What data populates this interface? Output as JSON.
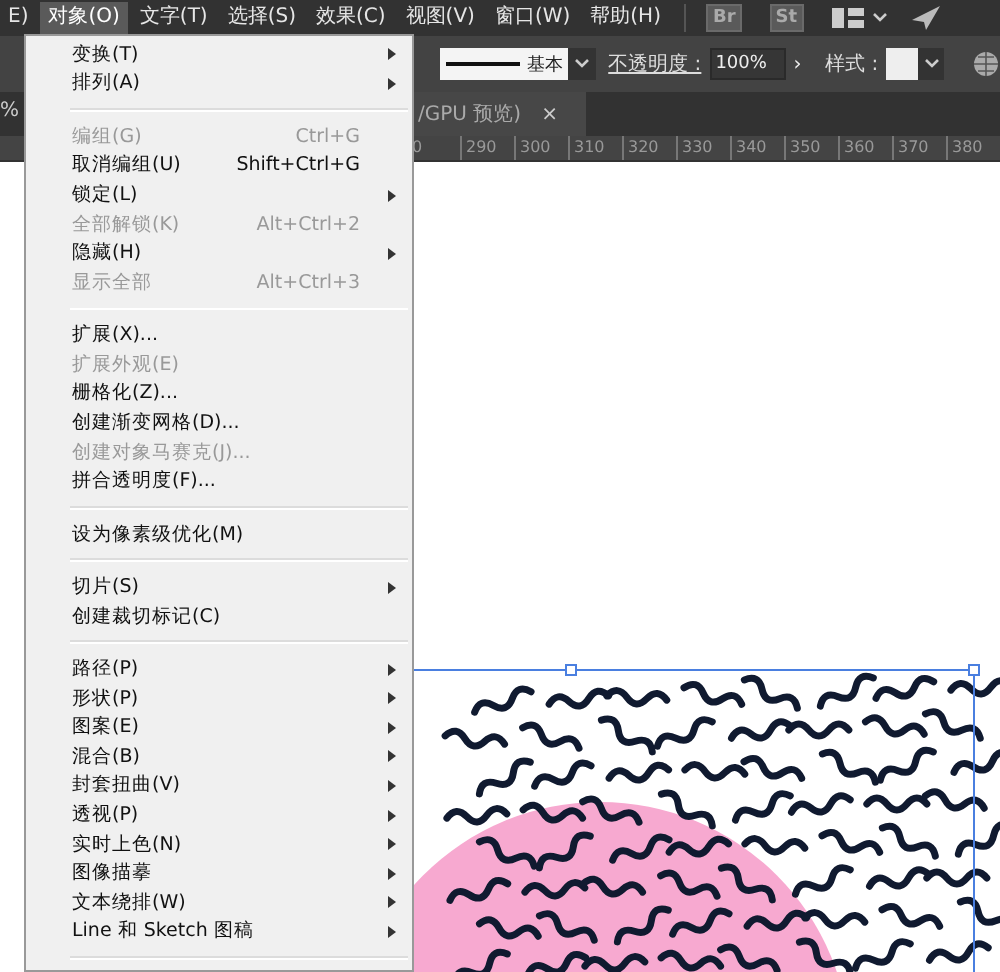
{
  "menubar": {
    "items": [
      {
        "label": "E)",
        "selected": false
      },
      {
        "label": "对象(O)",
        "selected": true
      },
      {
        "label": "文字(T)",
        "selected": false
      },
      {
        "label": "选择(S)",
        "selected": false
      },
      {
        "label": "效果(C)",
        "selected": false
      },
      {
        "label": "视图(V)",
        "selected": false
      },
      {
        "label": "窗口(W)",
        "selected": false
      },
      {
        "label": "帮助(H)",
        "selected": false
      }
    ],
    "apps": [
      "Br",
      "St"
    ]
  },
  "control_bar": {
    "left_fragment": "%",
    "stroke_label": "基本",
    "opacity_label": "不透明度 :",
    "opacity_value": "100%",
    "opacity_arrow": "›",
    "style_label": "样式 :"
  },
  "document_tab": {
    "title": "/GPU 预览)",
    "close": "×"
  },
  "ruler": {
    "ticks": [
      "0",
      "290",
      "300",
      "310",
      "320",
      "330",
      "340",
      "350",
      "360",
      "370",
      "380"
    ]
  },
  "menu": {
    "items": [
      {
        "kind": "item",
        "label": "变换(T)",
        "submenu": true,
        "disabled": false
      },
      {
        "kind": "item",
        "label": "排列(A)",
        "submenu": true,
        "disabled": false
      },
      {
        "kind": "separator"
      },
      {
        "kind": "item",
        "label": "编组(G)",
        "shortcut": "Ctrl+G",
        "submenu": false,
        "disabled": true
      },
      {
        "kind": "item",
        "label": "取消编组(U)",
        "shortcut": "Shift+Ctrl+G",
        "submenu": false,
        "disabled": false
      },
      {
        "kind": "item",
        "label": "锁定(L)",
        "submenu": true,
        "disabled": false
      },
      {
        "kind": "item",
        "label": "全部解锁(K)",
        "shortcut": "Alt+Ctrl+2",
        "submenu": false,
        "disabled": true
      },
      {
        "kind": "item",
        "label": "隐藏(H)",
        "submenu": true,
        "disabled": false
      },
      {
        "kind": "item",
        "label": "显示全部",
        "shortcut": "Alt+Ctrl+3",
        "submenu": false,
        "disabled": true
      },
      {
        "kind": "separator"
      },
      {
        "kind": "item",
        "label": "扩展(X)...",
        "submenu": false,
        "disabled": false
      },
      {
        "kind": "item",
        "label": "扩展外观(E)",
        "submenu": false,
        "disabled": true
      },
      {
        "kind": "item",
        "label": "栅格化(Z)...",
        "submenu": false,
        "disabled": false
      },
      {
        "kind": "item",
        "label": "创建渐变网格(D)...",
        "submenu": false,
        "disabled": false
      },
      {
        "kind": "item",
        "label": "创建对象马赛克(J)...",
        "submenu": false,
        "disabled": true
      },
      {
        "kind": "item",
        "label": "拼合透明度(F)...",
        "submenu": false,
        "disabled": false
      },
      {
        "kind": "separator"
      },
      {
        "kind": "item",
        "label": "设为像素级优化(M)",
        "submenu": false,
        "disabled": false
      },
      {
        "kind": "separator"
      },
      {
        "kind": "item",
        "label": "切片(S)",
        "submenu": true,
        "disabled": false
      },
      {
        "kind": "item",
        "label": "创建裁切标记(C)",
        "submenu": false,
        "disabled": false
      },
      {
        "kind": "separator"
      },
      {
        "kind": "item",
        "label": "路径(P)",
        "submenu": true,
        "disabled": false
      },
      {
        "kind": "item",
        "label": "形状(P)",
        "submenu": true,
        "disabled": false
      },
      {
        "kind": "item",
        "label": "图案(E)",
        "submenu": true,
        "disabled": false
      },
      {
        "kind": "item",
        "label": "混合(B)",
        "submenu": true,
        "disabled": false
      },
      {
        "kind": "item",
        "label": "封套扭曲(V)",
        "submenu": true,
        "disabled": false
      },
      {
        "kind": "item",
        "label": "透视(P)",
        "submenu": true,
        "disabled": false
      },
      {
        "kind": "item",
        "label": "实时上色(N)",
        "submenu": true,
        "disabled": false
      },
      {
        "kind": "item",
        "label": "图像描摹",
        "submenu": true,
        "disabled": false
      },
      {
        "kind": "item",
        "label": "文本绕排(W)",
        "submenu": true,
        "disabled": false
      },
      {
        "kind": "item",
        "label": "Line 和 Sketch 图稿",
        "submenu": true,
        "disabled": false
      },
      {
        "kind": "separator"
      }
    ]
  }
}
